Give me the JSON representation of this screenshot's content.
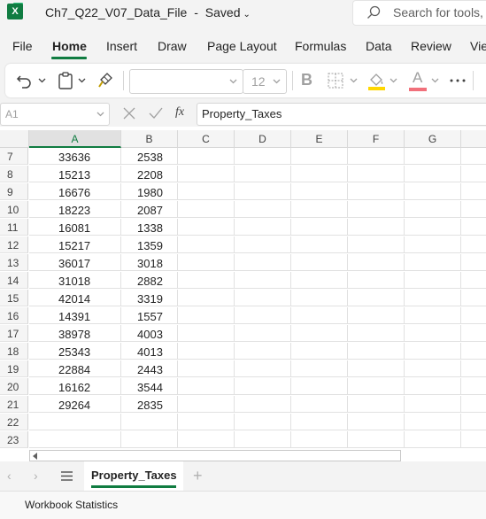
{
  "titlebar": {
    "app_icon_letter": "X",
    "document_name": "Ch7_Q22_V07_Data_File",
    "separator": "-",
    "save_status": "Saved",
    "search_placeholder": "Search for tools, he"
  },
  "menu": {
    "items": [
      "File",
      "Home",
      "Insert",
      "Draw",
      "Page Layout",
      "Formulas",
      "Data",
      "Review",
      "Vie"
    ],
    "active": "Home"
  },
  "toolbar": {
    "font_name": "",
    "font_size": "12",
    "icons": [
      "undo-icon",
      "paste-icon",
      "format-painter-icon",
      "bold-icon",
      "borders-icon",
      "fill-color-icon",
      "font-color-icon",
      "more-icon"
    ],
    "fill_color": "#ffd700",
    "font_color": "#e81123"
  },
  "formula_bar": {
    "name_box": "A1",
    "fx_label": "fx",
    "formula": "Property_Taxes"
  },
  "grid": {
    "columns": [
      "A",
      "B",
      "C",
      "D",
      "E",
      "F",
      "G"
    ],
    "active_column": "A",
    "rows": [
      {
        "num": "7",
        "a": "33636",
        "b": "2538"
      },
      {
        "num": "8",
        "a": "15213",
        "b": "2208"
      },
      {
        "num": "9",
        "a": "16676",
        "b": "1980"
      },
      {
        "num": "10",
        "a": "18223",
        "b": "2087"
      },
      {
        "num": "11",
        "a": "16081",
        "b": "1338"
      },
      {
        "num": "12",
        "a": "15217",
        "b": "1359"
      },
      {
        "num": "13",
        "a": "36017",
        "b": "3018"
      },
      {
        "num": "14",
        "a": "31018",
        "b": "2882"
      },
      {
        "num": "15",
        "a": "42014",
        "b": "3319"
      },
      {
        "num": "16",
        "a": "14391",
        "b": "1557"
      },
      {
        "num": "17",
        "a": "38978",
        "b": "4003"
      },
      {
        "num": "18",
        "a": "25343",
        "b": "4013"
      },
      {
        "num": "19",
        "a": "22884",
        "b": "2443"
      },
      {
        "num": "20",
        "a": "16162",
        "b": "3544"
      },
      {
        "num": "21",
        "a": "29264",
        "b": "2835"
      },
      {
        "num": "22",
        "a": "",
        "b": ""
      },
      {
        "num": "23",
        "a": "",
        "b": ""
      }
    ]
  },
  "sheets": {
    "tabs": [
      "Property_Taxes"
    ],
    "active": "Property_Taxes",
    "add_label": "+"
  },
  "status": {
    "text": "Workbook Statistics"
  },
  "colors": {
    "accent": "#107c41"
  }
}
